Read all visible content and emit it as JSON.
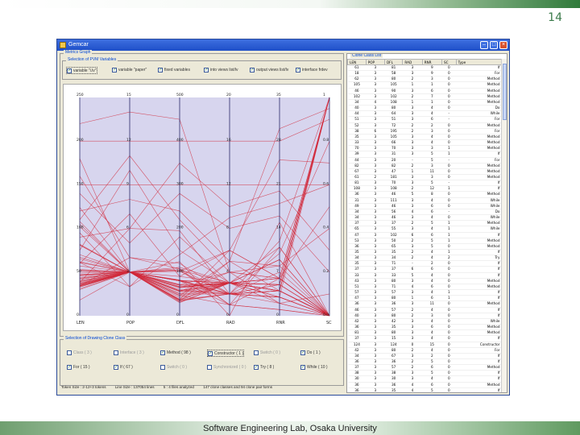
{
  "slide": {
    "page_number": "14",
    "footer": "Software Engineering Lab, Osaka University"
  },
  "window": {
    "title": "Gemcar",
    "left_group_label": "Metrics Graph",
    "variables_label": "Selection of PVM Variables",
    "variables": [
      {
        "label": "variable \"i.lv\"",
        "checked": true
      },
      {
        "label": "variable \"paper\"",
        "checked": true
      },
      {
        "label": "fixed variables",
        "checked": true
      },
      {
        "label": "into views list/lv",
        "checked": true
      },
      {
        "label": "output views list/lv",
        "checked": true
      },
      {
        "label": "interface frdev",
        "checked": true
      }
    ],
    "selection_label": "Selection of Drawing Clone Class",
    "selection_options": [
      {
        "label": "Class ( 3 )",
        "checked": false
      },
      {
        "label": "Interface ( 3 )",
        "checked": false
      },
      {
        "label": "Method ( 98 )",
        "checked": true
      },
      {
        "label": "Constructor ( 1 )",
        "checked": true
      },
      {
        "label": "Switch ( 0 )",
        "checked": false
      },
      {
        "label": "Do ( 1 )",
        "checked": true
      },
      {
        "label": "For ( 15 )",
        "checked": true
      },
      {
        "label": "If ( 67 )",
        "checked": true
      },
      {
        "label": "Switch ( 0 )",
        "checked": false
      },
      {
        "label": "Synchronized ( 0 )",
        "checked": false
      },
      {
        "label": "Try ( 8 )",
        "checked": true
      },
      {
        "label": "While ( 10 )",
        "checked": true
      }
    ],
    "status": {
      "token_size": "Token Size : 2-12+3 tokens",
      "line_size": "Line Size : 137054 lines",
      "files": "5 : 4 files analyzed",
      "clones": "147 clone classes and 94 clone pair forms"
    },
    "right_label": "Clone Class List",
    "table": {
      "columns": [
        "LEN",
        "POP",
        "DFL",
        "RAD",
        "RNR",
        "SC",
        "Type"
      ],
      "rows": [
        [
          "61",
          "3",
          "81",
          "3",
          "9",
          "0",
          "If"
        ],
        [
          "18",
          "3",
          "58",
          "3",
          "9",
          "0",
          "For"
        ],
        [
          "62",
          "3",
          "80",
          "2",
          "3",
          "0",
          "Method"
        ],
        [
          "105",
          "3",
          "105",
          "1",
          "1",
          "0",
          "Method"
        ],
        [
          "46",
          "3",
          "90",
          "3",
          "6",
          "0",
          "Method"
        ],
        [
          "102",
          "3",
          "102",
          "2",
          "7",
          "0",
          "Method"
        ],
        [
          "34",
          "4",
          "108",
          "1",
          "1",
          "0",
          "Method"
        ],
        [
          "40",
          "3",
          "80",
          "3",
          "4",
          "0",
          "Do"
        ],
        [
          "44",
          "3",
          "64",
          "3",
          "4",
          "-",
          "While"
        ],
        [
          "51",
          "3",
          "51",
          "3",
          "6",
          "-",
          "For"
        ],
        [
          "52",
          "3",
          "72",
          "2",
          "2",
          "0",
          "Method"
        ],
        [
          "38",
          "6",
          "195",
          "2",
          "3",
          "0",
          "For"
        ],
        [
          "35",
          "3",
          "105",
          "3",
          "4",
          "0",
          "Method"
        ],
        [
          "33",
          "3",
          "66",
          "3",
          "4",
          "0",
          "Method"
        ],
        [
          "70",
          "3",
          "70",
          "3",
          "3",
          "1",
          "Method"
        ],
        [
          "39",
          "3",
          "31",
          "3",
          "5",
          "1",
          "If"
        ],
        [
          "44",
          "3",
          "20",
          "-",
          "5",
          "-",
          "For"
        ],
        [
          "82",
          "3",
          "82",
          "2",
          "3",
          "0",
          "Method"
        ],
        [
          "67",
          "3",
          "47",
          "1",
          "11",
          "0",
          "Method"
        ],
        [
          "61",
          "2",
          "181",
          "3",
          "3",
          "0",
          "Method"
        ],
        [
          "81",
          "3",
          "70",
          "3",
          "5",
          "-",
          "If"
        ],
        [
          "108",
          "3",
          "108",
          "2",
          "12",
          "1",
          "If"
        ],
        [
          "36",
          "3",
          "46",
          "5",
          "8",
          "0",
          "Method"
        ],
        [
          "31",
          "3",
          "111",
          "3",
          "4",
          "0",
          "While"
        ],
        [
          "49",
          "3",
          "46",
          "3",
          "6",
          "0",
          "While"
        ],
        [
          "34",
          "3",
          "56",
          "4",
          "6",
          "-",
          "Do"
        ],
        [
          "34",
          "3",
          "46",
          "3",
          "4",
          "0",
          "While"
        ],
        [
          "37",
          "3",
          "37",
          "2",
          "5",
          "1",
          "Method"
        ],
        [
          "65",
          "3",
          "55",
          "3",
          "4",
          "1",
          "While"
        ],
        [
          "47",
          "3",
          "102",
          "6",
          "6",
          "1",
          "If"
        ],
        [
          "53",
          "3",
          "50",
          "2",
          "5",
          "1",
          "Method"
        ],
        [
          "36",
          "3",
          "65",
          "3",
          "5",
          "0",
          "Method"
        ],
        [
          "35",
          "3",
          "35",
          "2",
          "4",
          "1",
          "If"
        ],
        [
          "34",
          "3",
          "34",
          "2",
          "4",
          "2",
          "Try"
        ],
        [
          "35",
          "3",
          "71",
          "-",
          "2",
          "0",
          "If"
        ],
        [
          "37",
          "3",
          "37",
          "6",
          "6",
          "0",
          "If"
        ],
        [
          "33",
          "3",
          "33",
          "5",
          "4",
          "0",
          "If"
        ],
        [
          "43",
          "3",
          "80",
          "3",
          "4",
          "0",
          "Method"
        ],
        [
          "51",
          "3",
          "71",
          "4",
          "6",
          "0",
          "Method"
        ],
        [
          "57",
          "3",
          "57",
          "3",
          "4",
          "1",
          "If"
        ],
        [
          "47",
          "3",
          "80",
          "1",
          "6",
          "1",
          "If"
        ],
        [
          "36",
          "3",
          "36",
          "3",
          "11",
          "0",
          "Method"
        ],
        [
          "46",
          "3",
          "57",
          "2",
          "4",
          "0",
          "If"
        ],
        [
          "40",
          "3",
          "80",
          "2",
          "3",
          "0",
          "If"
        ],
        [
          "42",
          "3",
          "42",
          "3",
          "4",
          "0",
          "While"
        ],
        [
          "36",
          "3",
          "35",
          "3",
          "6",
          "0",
          "Method"
        ],
        [
          "81",
          "3",
          "80",
          "3",
          "4",
          "0",
          "Method"
        ],
        [
          "37",
          "3",
          "15",
          "3",
          "4",
          "0",
          "If"
        ],
        [
          "124",
          "3",
          "124",
          "0",
          "15",
          "0",
          "Constructor"
        ],
        [
          "42",
          "3",
          "80",
          "2",
          "4",
          "0",
          "For"
        ],
        [
          "34",
          "3",
          "67",
          "3",
          "2",
          "0",
          "If"
        ],
        [
          "36",
          "3",
          "36",
          "2",
          "5",
          "0",
          "If"
        ],
        [
          "37",
          "3",
          "57",
          "2",
          "6",
          "0",
          "Method"
        ],
        [
          "38",
          "3",
          "38",
          "3",
          "5",
          "0",
          "If"
        ],
        [
          "30",
          "3",
          "30",
          "3",
          "4",
          "0",
          "If"
        ],
        [
          "36",
          "3",
          "36",
          "4",
          "6",
          "0",
          "Method"
        ],
        [
          "36",
          "3",
          "35",
          "4",
          "5",
          "0",
          "If"
        ],
        [
          "35",
          "3",
          "35",
          "4",
          "5",
          "0",
          "If"
        ]
      ]
    }
  },
  "chart_data": {
    "type": "parallel-coordinates",
    "axes": [
      {
        "label": "LEN",
        "max": 250,
        "ticks": [
          "250",
          "200",
          "150",
          "100",
          "50",
          "0"
        ]
      },
      {
        "label": "POP",
        "max": 15,
        "ticks": [
          "15",
          "12",
          "9",
          "6",
          "3",
          "0"
        ]
      },
      {
        "label": "DFL",
        "max": 500,
        "ticks": [
          "500",
          "400",
          "300",
          "200",
          "100",
          "0"
        ]
      },
      {
        "label": "RAD",
        "max": 20,
        "ticks": [
          "20",
          "16",
          "12",
          "8",
          "4",
          "0"
        ]
      },
      {
        "label": "RNR",
        "max": 35,
        "ticks": [
          "35",
          "28",
          "21",
          "14",
          "7",
          "0"
        ]
      },
      {
        "label": "SC",
        "max": 1.0,
        "ticks": [
          "1",
          "0.8",
          "0.6",
          "0.4",
          "0.2",
          "0.0"
        ]
      }
    ],
    "axis_colors": {
      "background": "#d7d5ee",
      "line": "#d1283a"
    },
    "grid": false,
    "lines": [
      [
        61,
        3,
        81,
        3,
        9,
        0
      ],
      [
        18,
        3,
        58,
        3,
        9,
        0
      ],
      [
        62,
        3,
        80,
        2,
        3,
        0
      ],
      [
        105,
        3,
        105,
        1,
        1,
        0
      ],
      [
        46,
        3,
        90,
        3,
        6,
        0
      ],
      [
        102,
        3,
        102,
        2,
        7,
        0
      ],
      [
        34,
        4,
        108,
        1,
        1,
        0
      ],
      [
        40,
        3,
        80,
        3,
        4,
        0
      ],
      [
        44,
        3,
        64,
        3,
        4,
        0
      ],
      [
        51,
        3,
        51,
        3,
        6,
        0
      ],
      [
        52,
        3,
        72,
        2,
        2,
        0
      ],
      [
        38,
        6,
        195,
        2,
        3,
        0
      ],
      [
        35,
        3,
        105,
        3,
        4,
        0
      ],
      [
        33,
        3,
        66,
        3,
        4,
        0
      ],
      [
        70,
        3,
        70,
        3,
        3,
        1
      ],
      [
        39,
        3,
        31,
        3,
        5,
        1
      ],
      [
        82,
        3,
        82,
        2,
        3,
        0
      ],
      [
        67,
        3,
        47,
        1,
        11,
        0
      ],
      [
        61,
        2,
        181,
        3,
        3,
        0
      ],
      [
        81,
        3,
        70,
        3,
        5,
        0
      ],
      [
        108,
        3,
        108,
        2,
        12,
        1
      ],
      [
        36,
        3,
        46,
        5,
        8,
        0
      ],
      [
        31,
        3,
        111,
        3,
        4,
        0
      ],
      [
        49,
        3,
        46,
        3,
        6,
        0
      ],
      [
        34,
        3,
        56,
        4,
        6,
        0
      ],
      [
        37,
        3,
        37,
        2,
        5,
        1
      ],
      [
        65,
        3,
        55,
        3,
        4,
        1
      ],
      [
        47,
        3,
        102,
        6,
        6,
        1
      ],
      [
        53,
        3,
        50,
        2,
        5,
        1
      ],
      [
        36,
        3,
        65,
        3,
        5,
        0
      ],
      [
        35,
        3,
        35,
        2,
        4,
        1
      ],
      [
        34,
        3,
        34,
        2,
        4,
        2
      ],
      [
        37,
        3,
        37,
        6,
        6,
        0
      ],
      [
        33,
        3,
        33,
        5,
        4,
        0
      ],
      [
        43,
        3,
        80,
        3,
        4,
        0
      ],
      [
        51,
        3,
        71,
        4,
        6,
        0
      ],
      [
        57,
        3,
        57,
        3,
        4,
        1
      ],
      [
        47,
        3,
        80,
        1,
        6,
        1
      ],
      [
        36,
        3,
        36,
        3,
        11,
        0
      ],
      [
        46,
        3,
        57,
        2,
        4,
        0
      ],
      [
        40,
        3,
        80,
        2,
        3,
        0
      ],
      [
        42,
        3,
        42,
        3,
        4,
        0
      ],
      [
        81,
        3,
        80,
        3,
        4,
        0
      ],
      [
        124,
        3,
        124,
        0,
        15,
        0
      ],
      [
        42,
        3,
        80,
        2,
        4,
        0
      ],
      [
        34,
        3,
        67,
        3,
        2,
        0
      ],
      [
        38,
        3,
        38,
        3,
        5,
        0
      ],
      [
        30,
        3,
        30,
        3,
        4,
        0
      ],
      [
        200,
        12,
        400,
        16,
        28,
        0.9
      ],
      [
        150,
        9,
        300,
        12,
        21,
        0.6
      ],
      [
        220,
        14,
        450,
        4,
        2,
        0.1
      ],
      [
        120,
        8,
        240,
        5,
        30,
        0.95
      ],
      [
        90,
        6,
        350,
        10,
        20,
        0.3
      ],
      [
        160,
        4,
        120,
        2,
        10,
        0.8
      ],
      [
        75,
        10,
        150,
        3,
        6,
        0.5
      ],
      [
        140,
        5,
        280,
        8,
        16,
        0.2
      ],
      [
        60,
        7,
        90,
        6,
        25,
        0.7
      ],
      [
        180,
        3,
        60,
        2,
        4,
        1
      ],
      [
        110,
        11,
        220,
        4,
        8,
        0.4
      ],
      [
        95,
        2,
        140,
        9,
        18,
        0.6
      ]
    ]
  }
}
